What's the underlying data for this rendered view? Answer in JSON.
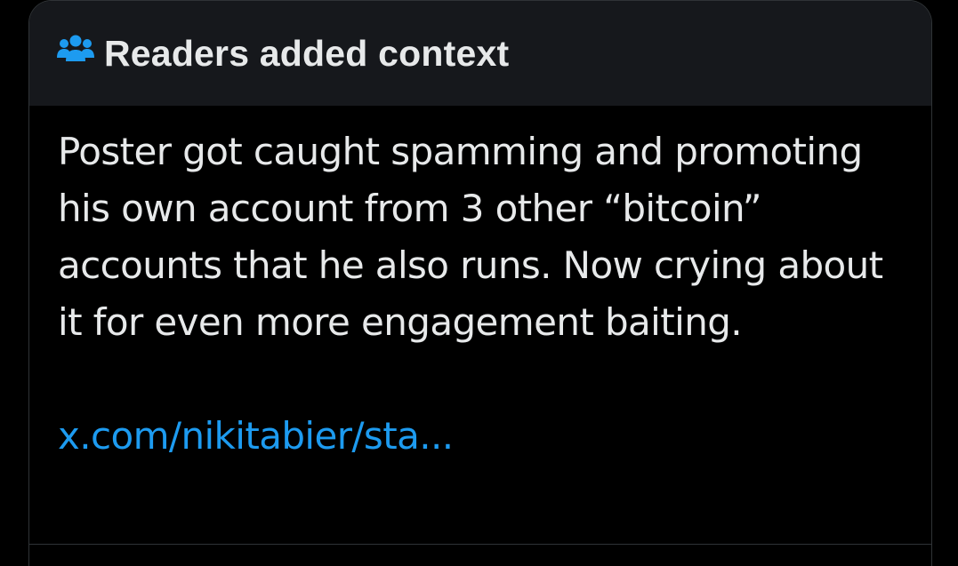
{
  "note": {
    "header_title": "Readers added context",
    "header_icon": "people-icon",
    "body_text": "Poster got caught spamming and promoting his own account from 3 other “bitcoin” accounts that he also runs.  Now crying about it for even more engagement baiting.",
    "link_text": "x.com/nikitabier/sta...",
    "colors": {
      "accent": "#1d9bf0",
      "text": "#e7e9ea",
      "header_bg": "#16181c",
      "background": "#000000",
      "border": "#2f3336"
    }
  }
}
